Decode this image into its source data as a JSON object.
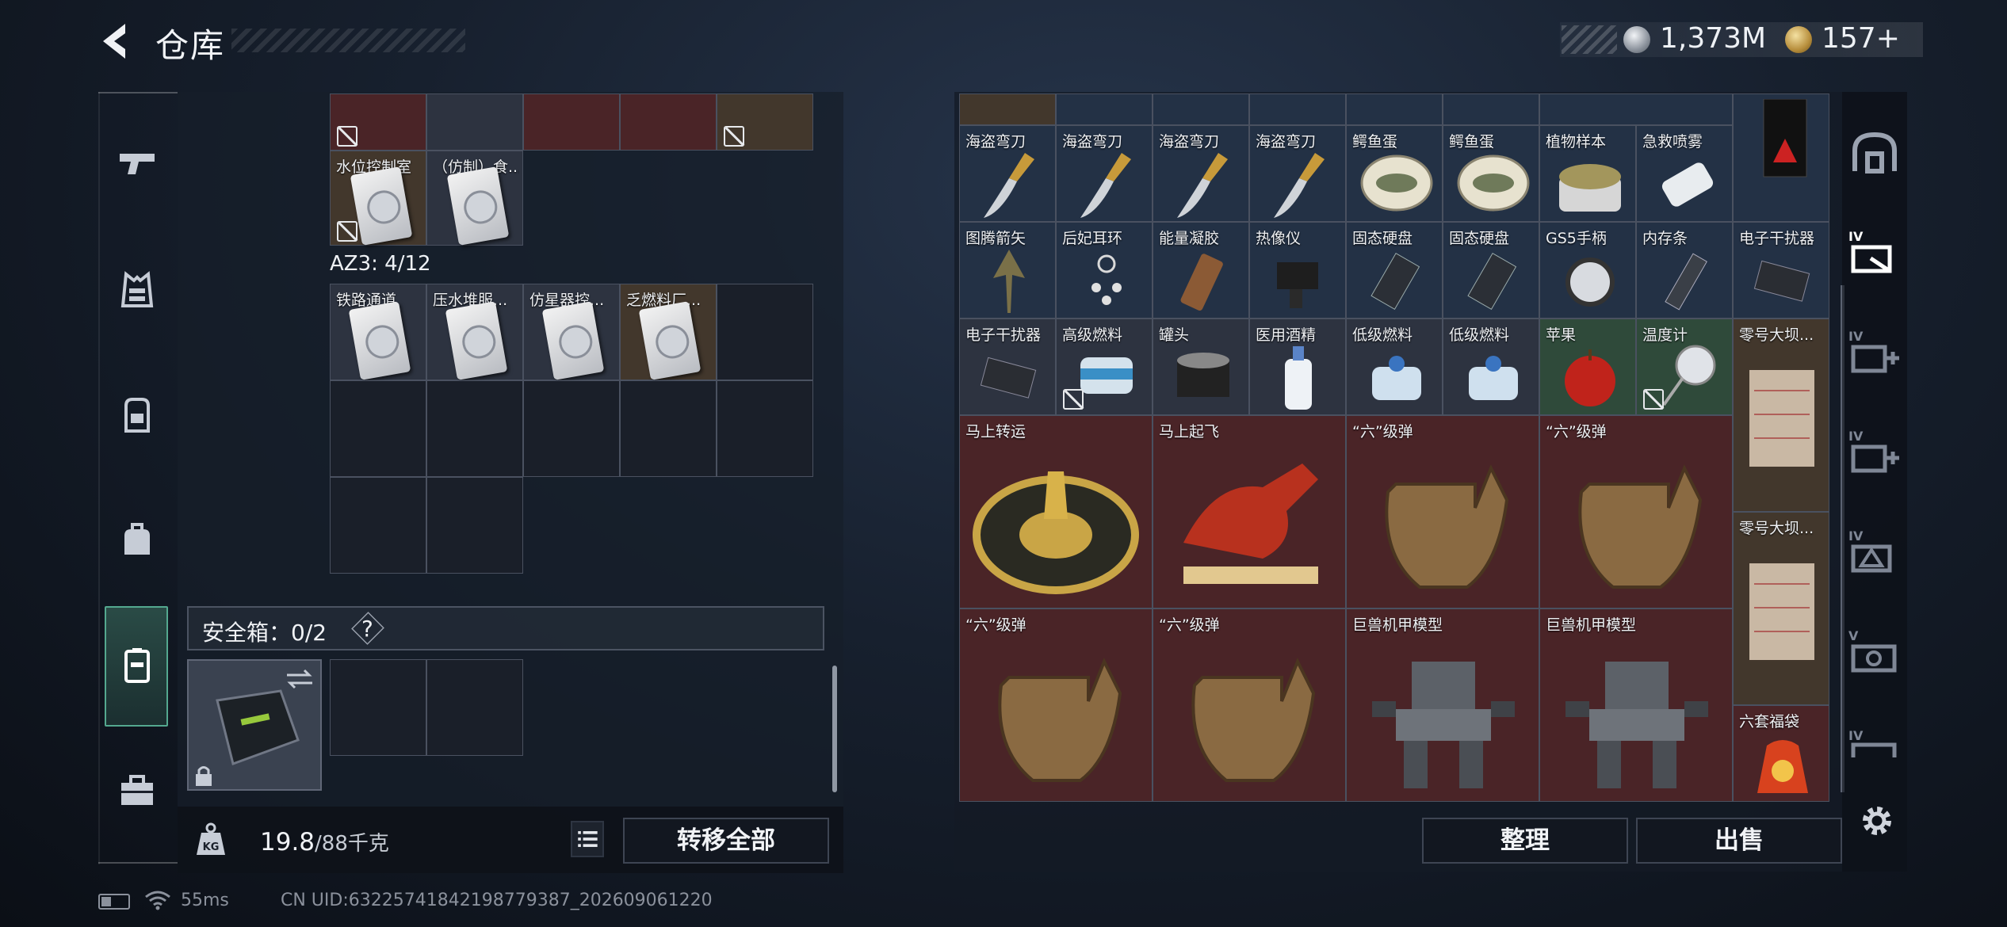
{
  "header": {
    "title": "仓库",
    "currency_silver": "1,373M",
    "currency_gold": "157+"
  },
  "left_rail": {
    "tabs": [
      {
        "name": "weapons",
        "icon": "pistol-icon"
      },
      {
        "name": "armor",
        "icon": "vest-icon"
      },
      {
        "name": "backpack",
        "icon": "backpack-icon"
      },
      {
        "name": "bag",
        "icon": "bag-icon"
      },
      {
        "name": "safe-box",
        "icon": "safe-box-icon",
        "active": true
      },
      {
        "name": "toolbox",
        "icon": "toolbox-icon"
      }
    ]
  },
  "storage": {
    "top_items": [
      {
        "label": "水位控制室",
        "locked": true
      },
      {
        "label": "（仿制）食...",
        "locked": false
      }
    ],
    "az_label": "AZ3: 4/12",
    "az_items": [
      {
        "label": "铁路通道"
      },
      {
        "label": "压水堆服..."
      },
      {
        "label": "仿星器控..."
      },
      {
        "label": "乏燃料厂..."
      }
    ],
    "safe_box_label": "安全箱：0/2",
    "help": "?"
  },
  "footer_left": {
    "weight_current": "19.8",
    "weight_max": "/88千克",
    "transfer_all": "转移全部"
  },
  "grid": {
    "row1": [
      "海盗弯刀",
      "海盗弯刀",
      "海盗弯刀",
      "海盗弯刀",
      "鳄鱼蛋",
      "鳄鱼蛋",
      "植物样本",
      "急救喷雾"
    ],
    "row2": [
      "图腾箭矢",
      "后妃耳环",
      "能量凝胶",
      "热像仪",
      "固态硬盘",
      "固态硬盘",
      "GS5手柄",
      "内存条",
      "电子干扰器"
    ],
    "row3": [
      "电子干扰器",
      "高级燃料",
      "罐头",
      "医用酒精",
      "低级燃料",
      "低级燃料",
      "苹果",
      "温度计"
    ],
    "big_row1": [
      "马上转运",
      "马上起飞",
      "“六”级弹",
      "“六”级弹"
    ],
    "big_row2": [
      "“六”级弹",
      "“六”级弹",
      "巨兽机甲模型",
      "巨兽机甲模型"
    ],
    "side_items": [
      "零号大坝...",
      "零号大坝...",
      "六套福袋"
    ]
  },
  "actions": {
    "organize": "整理",
    "sell": "出售"
  },
  "status_bar": {
    "ping": "55ms",
    "uid": "CN UID:6322574184219877938​7_202609061220"
  }
}
